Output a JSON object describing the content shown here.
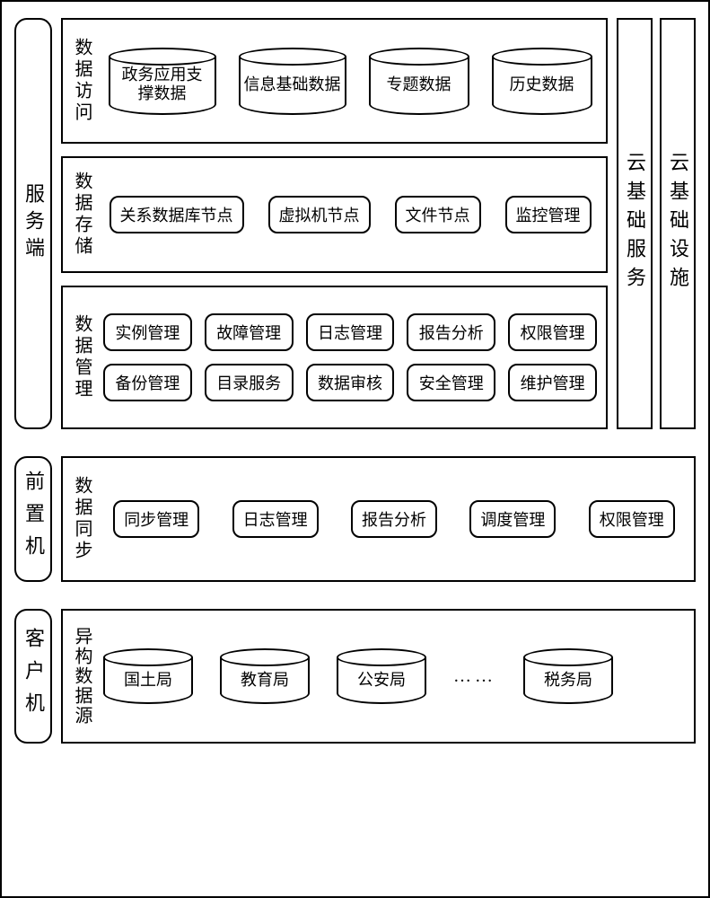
{
  "tiers": {
    "server": {
      "label": "服务端",
      "side_columns": [
        "云基础服务",
        "云基础设施"
      ],
      "panels": {
        "data_access": {
          "label": "数据访问",
          "cylinders": [
            "政务应用支\n撑数据",
            "信息基础数据",
            "专题数据",
            "历史数据"
          ]
        },
        "data_storage": {
          "label": "数据存储",
          "chips": [
            "关系数据库节点",
            "虚拟机节点",
            "文件节点",
            "监控管理"
          ]
        },
        "data_mgmt": {
          "label": "数据管理",
          "chips": [
            "实例管理",
            "故障管理",
            "日志管理",
            "报告分析",
            "权限管理",
            "备份管理",
            "目录服务",
            "数据审核",
            "安全管理",
            "维护管理"
          ]
        }
      }
    },
    "front": {
      "label": "前置机",
      "panel": {
        "label": "数据同步",
        "chips": [
          "同步管理",
          "日志管理",
          "报告分析",
          "调度管理",
          "权限管理"
        ]
      }
    },
    "client": {
      "label": "客户机",
      "panel": {
        "label": "异构数据源",
        "cylinders": [
          "国土局",
          "教育局",
          "公安局"
        ],
        "ellipsis": "……",
        "trailing": "税务局"
      }
    }
  }
}
